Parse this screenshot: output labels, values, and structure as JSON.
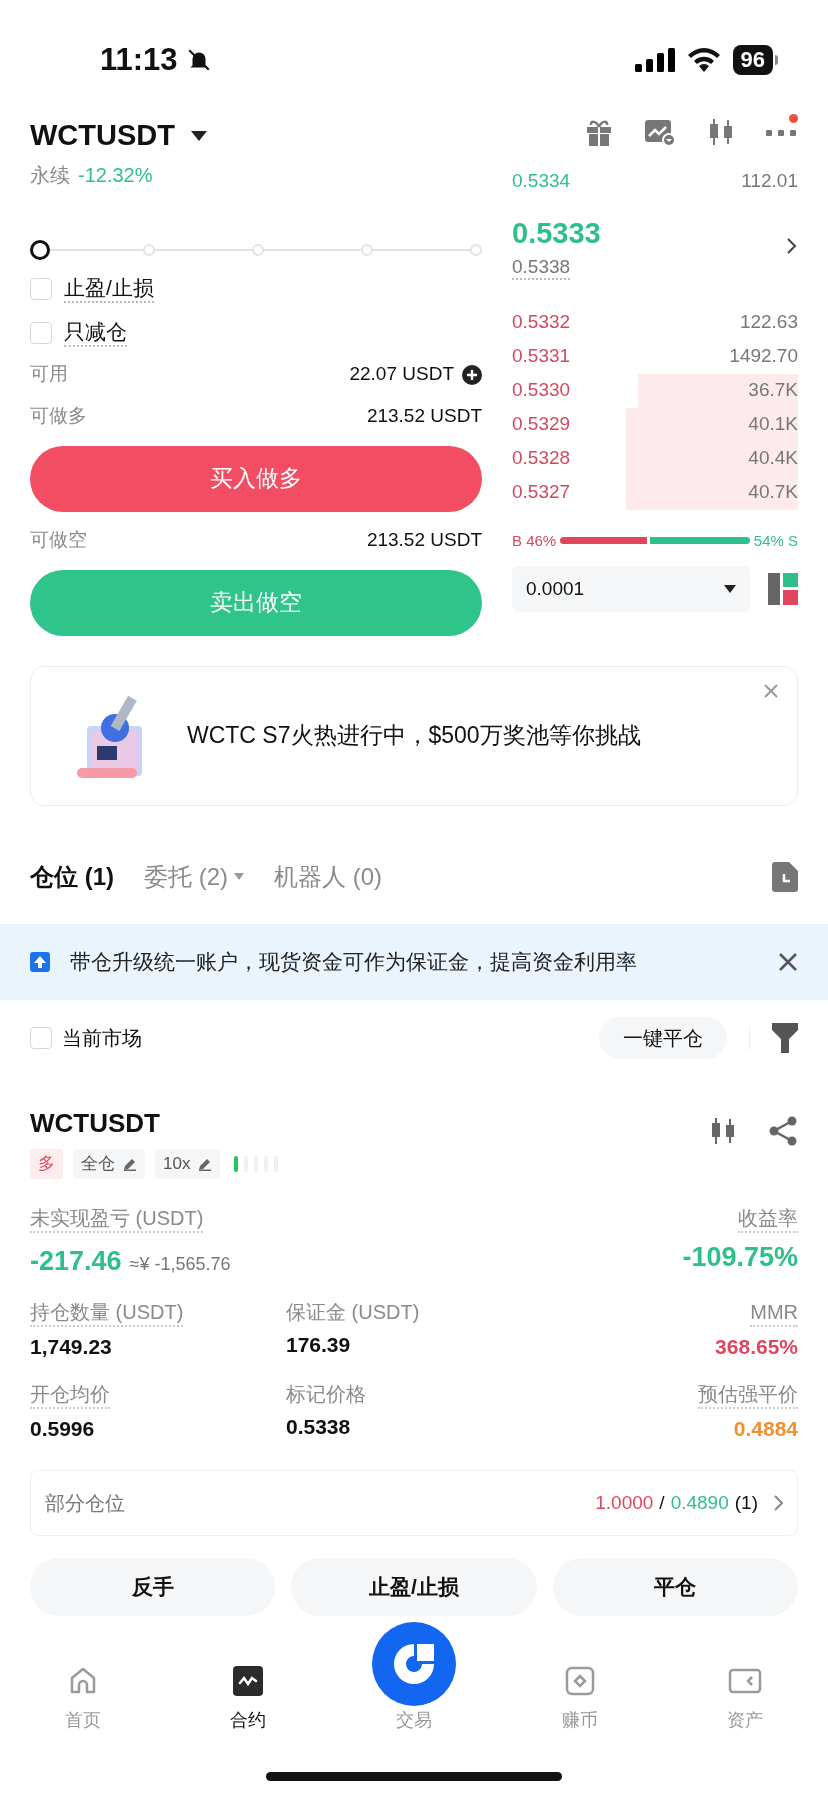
{
  "status_bar": {
    "time": "11:13",
    "battery": "96"
  },
  "header": {
    "symbol": "WCTUSDT",
    "type": "永续",
    "change": "-12.32%"
  },
  "slider": {
    "level": 0
  },
  "options": [
    {
      "label": "止盈/止损",
      "checked": false
    },
    {
      "label": "只减仓",
      "checked": false
    }
  ],
  "order_form": {
    "available": {
      "label": "可用",
      "value": "22.07 USDT"
    },
    "long": {
      "label": "可做多",
      "value": "213.52 USDT",
      "button": "买入做多"
    },
    "short": {
      "label": "可做空",
      "value": "213.52 USDT",
      "button": "卖出做空"
    }
  },
  "orderbook": {
    "asks": [
      {
        "price": "0.5334",
        "amount": "112.01"
      }
    ],
    "last_price": "0.5333",
    "mark_price": "0.5338",
    "bids": [
      {
        "price": "0.5332",
        "amount": "122.63"
      },
      {
        "price": "0.5331",
        "amount": "1492.70"
      },
      {
        "price": "0.5330",
        "amount": "36.7K"
      },
      {
        "price": "0.5329",
        "amount": "40.1K"
      },
      {
        "price": "0.5328",
        "amount": "40.4K"
      },
      {
        "price": "0.5327",
        "amount": "40.7K"
      }
    ],
    "ratio": {
      "buy_label": "B 46%",
      "sell_label": "54% S",
      "level": 0.46
    },
    "precision": "0.0001"
  },
  "banner": {
    "text": "WCTC S7火热进行中，$500万奖池等你挑战"
  },
  "tabs": [
    {
      "label": "仓位 (1)",
      "selected": true,
      "dropdown": false
    },
    {
      "label": "委托 (2)",
      "selected": false,
      "dropdown": true
    },
    {
      "label": "机器人 (0)",
      "selected": false,
      "dropdown": false
    }
  ],
  "notice": {
    "text": "带仓升级统一账户，现货资金可作为保证金，提高资金利用率"
  },
  "filter": {
    "label": "当前市场",
    "checked": false,
    "close_all": "一键平仓"
  },
  "position": {
    "symbol": "WCTUSDT",
    "tags": [
      {
        "label": "多",
        "kind": "side"
      },
      {
        "label": "全仓",
        "kind": "editable"
      },
      {
        "label": "10x",
        "kind": "editable"
      }
    ],
    "pnl": {
      "label": "未实现盈亏 (USDT)",
      "value": "-217.46",
      "approx": "≈¥ -1,565.76"
    },
    "roe": {
      "label": "收益率",
      "value": "-109.75%"
    },
    "stats": [
      {
        "label": "持仓数量 (USDT)",
        "value": "1,749.23",
        "color": "#111111"
      },
      {
        "label": "保证金 (USDT)",
        "value": "176.39",
        "color": "#111111"
      },
      {
        "label": "MMR",
        "value": "368.65%",
        "color": "#e0475e"
      },
      {
        "label": "开仓均价",
        "value": "0.5996",
        "color": "#111111"
      },
      {
        "label": "标记价格",
        "value": "0.5338",
        "color": "#111111"
      },
      {
        "label": "预估强平价",
        "value": "0.4884",
        "color": "#f0902e"
      }
    ],
    "partial": {
      "label": "部分仓位",
      "tp": "1.0000",
      "separator": "/",
      "sl": "0.4890",
      "count": "(1)"
    }
  },
  "actions": [
    "反手",
    "止盈/止损",
    "平仓"
  ],
  "nav": [
    {
      "label": "首页",
      "kind": "home",
      "selected": false
    },
    {
      "label": "合约",
      "kind": "futures",
      "selected": true
    },
    {
      "label": "交易",
      "kind": "trade",
      "selected": false
    },
    {
      "label": "赚币",
      "kind": "earn",
      "selected": false
    },
    {
      "label": "资产",
      "kind": "assets",
      "selected": false
    }
  ]
}
